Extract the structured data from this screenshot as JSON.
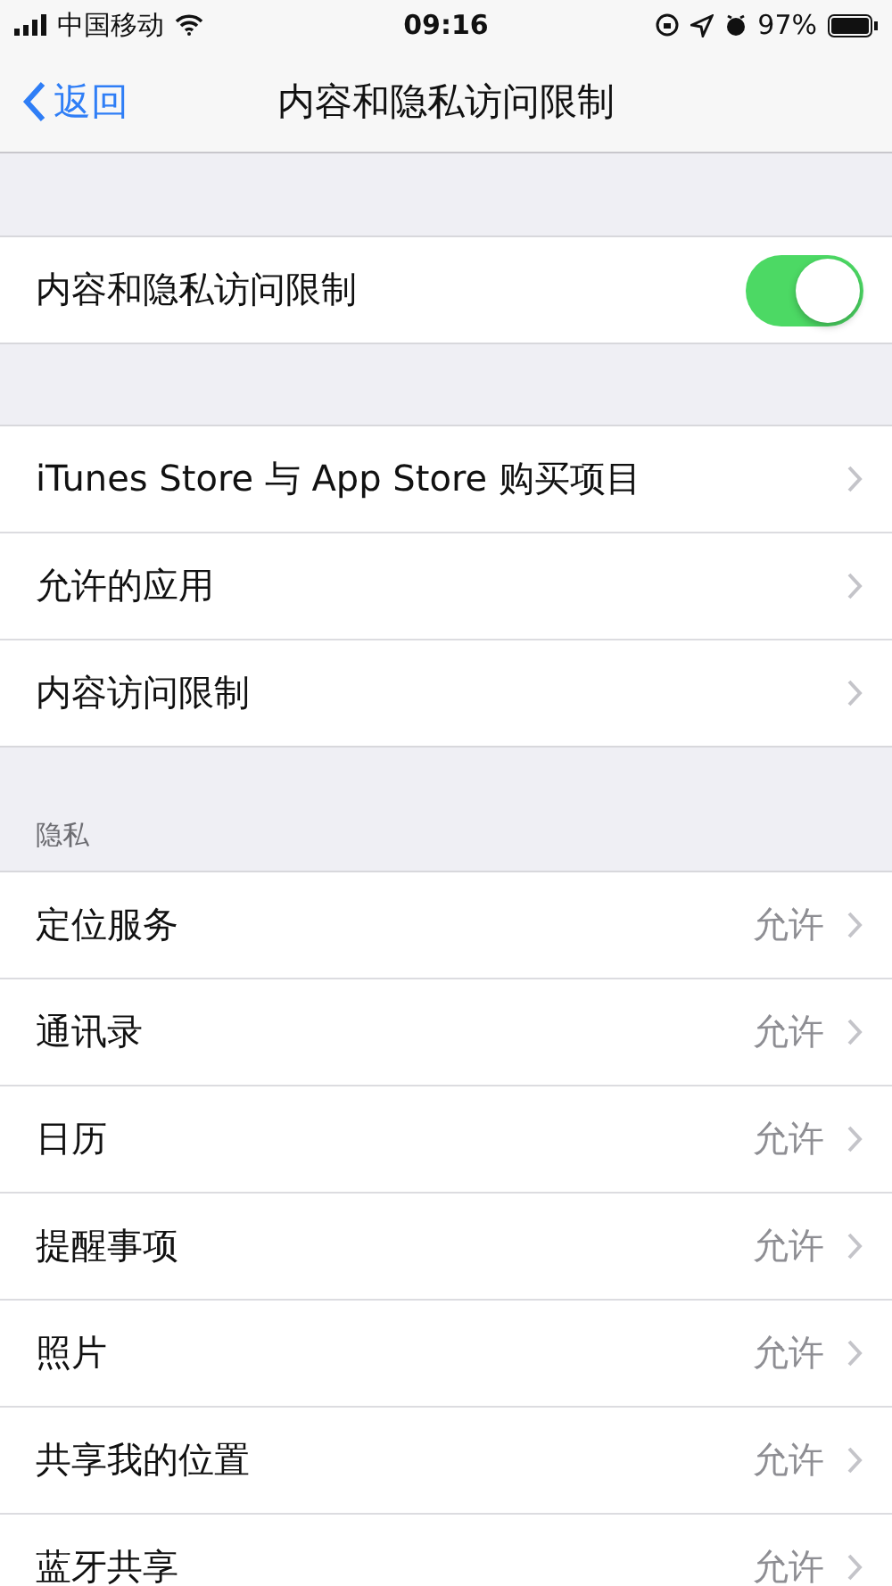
{
  "status_bar": {
    "carrier": "中国移动",
    "time": "09:16",
    "battery": "97%"
  },
  "nav_bar": {
    "back": "返回",
    "title": "内容和隐私访问限制"
  },
  "toggle_row": {
    "label": "内容和隐私访问限制",
    "on": true
  },
  "menu_rows": [
    {
      "label": "iTunes Store 与 App Store 购买项目"
    },
    {
      "label": "允许的应用"
    },
    {
      "label": "内容访问限制"
    }
  ],
  "privacy_section": {
    "header": "隐私",
    "rows": [
      {
        "label": "定位服务",
        "value": "允许"
      },
      {
        "label": "通讯录",
        "value": "允许"
      },
      {
        "label": "日历",
        "value": "允许"
      },
      {
        "label": "提醒事项",
        "value": "允许"
      },
      {
        "label": "照片",
        "value": "允许"
      },
      {
        "label": "共享我的位置",
        "value": "允许"
      },
      {
        "label": "蓝牙共享",
        "value": "允许"
      }
    ]
  }
}
